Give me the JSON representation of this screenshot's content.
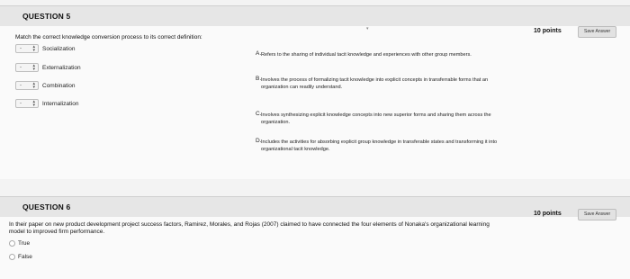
{
  "question5": {
    "title": "QUESTION 5",
    "points": "10 points",
    "save_label": "Save Answer",
    "prompt": "Match the correct knowledge conversion process to its correct definition:",
    "select_placeholder": "-",
    "items": [
      {
        "label": "Socialization"
      },
      {
        "label": "Externalization"
      },
      {
        "label": "Combination"
      },
      {
        "label": "Internalization"
      }
    ],
    "definitions": [
      {
        "letter": "A.",
        "text": "Refers to the sharing of individual tacit knowledge and experiences with other group members."
      },
      {
        "letter": "B.",
        "text": "Involves the process of formalizing tacit knowledge into explicit concepts in transferrable forms that an organization can readily understand."
      },
      {
        "letter": "C.",
        "text": "Involves synthesizing explicit knowledge concepts into new superior forms and sharing them across the organization."
      },
      {
        "letter": "D.",
        "text": "Includes the activities for absorbing explicit group knowledge in transferable states and transforming it into organizational tacit knowledge."
      }
    ]
  },
  "question6": {
    "title": "QUESTION 6",
    "points": "10 points",
    "save_label": "Save Answer",
    "prompt": "In their paper on new product development project success factors, Ramirez, Morales, and Rojas (2007) claimed to have connected the four elements of Nonaka's organizational learning model to improved firm performance.",
    "options": [
      {
        "label": "True"
      },
      {
        "label": "False"
      }
    ]
  }
}
